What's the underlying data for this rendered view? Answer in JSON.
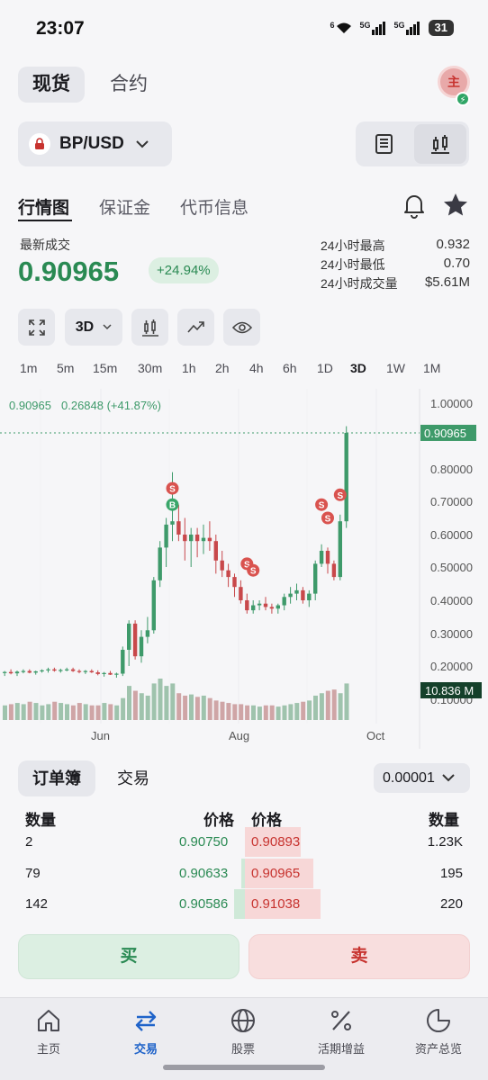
{
  "status": {
    "time": "23:07",
    "net1": "6",
    "net2": "5G",
    "net3": "5G",
    "battery": "31"
  },
  "top_tabs": [
    {
      "label": "现货",
      "active": true
    },
    {
      "label": "合约",
      "active": false
    }
  ],
  "avatar": {
    "text": "主",
    "badge": "⚡"
  },
  "pair": {
    "name": "BP/USD"
  },
  "sub_tabs": [
    {
      "label": "行情图",
      "active": true
    },
    {
      "label": "保证金",
      "active": false
    },
    {
      "label": "代币信息",
      "active": false
    }
  ],
  "ticker": {
    "last_label": "最新成交",
    "last_price": "0.90965",
    "change": "+24.94%",
    "stats": [
      {
        "label": "24小时最高",
        "value": "0.932"
      },
      {
        "label": "24小时最低",
        "value": "0.70"
      },
      {
        "label": "24小时成交量",
        "value": "$5.61M"
      }
    ]
  },
  "chart_toolbar": {
    "interval_select": "3D"
  },
  "timeframes": [
    "1m",
    "5m",
    "15m",
    "30m",
    "1h",
    "2h",
    "4h",
    "6h",
    "1D",
    "3D",
    "1W",
    "1M"
  ],
  "active_timeframe": "3D",
  "chart_data": {
    "type": "candlestick",
    "legend_text": {
      "price": "0.90965",
      "change": "0.26848 (+41.87%)"
    },
    "y_ticks": [
      "1.00000",
      "0.80000",
      "0.70000",
      "0.60000",
      "0.50000",
      "0.40000",
      "0.30000",
      "0.20000",
      "0.10000"
    ],
    "x_ticks": [
      "Jun",
      "Aug",
      "Oct"
    ],
    "price_tag": "0.90965",
    "volume_tag": "10.836 M",
    "ylim": [
      0.06,
      1.04
    ],
    "candles": [
      [
        0.18,
        0.185,
        0.17,
        0.182
      ],
      [
        0.182,
        0.19,
        0.175,
        0.178
      ],
      [
        0.178,
        0.186,
        0.17,
        0.183
      ],
      [
        0.183,
        0.19,
        0.178,
        0.185
      ],
      [
        0.185,
        0.19,
        0.178,
        0.18
      ],
      [
        0.18,
        0.186,
        0.174,
        0.184
      ],
      [
        0.184,
        0.19,
        0.18,
        0.187
      ],
      [
        0.187,
        0.195,
        0.18,
        0.19
      ],
      [
        0.19,
        0.195,
        0.183,
        0.186
      ],
      [
        0.186,
        0.192,
        0.18,
        0.188
      ],
      [
        0.188,
        0.195,
        0.184,
        0.19
      ],
      [
        0.19,
        0.195,
        0.182,
        0.185
      ],
      [
        0.185,
        0.19,
        0.178,
        0.182
      ],
      [
        0.182,
        0.188,
        0.176,
        0.185
      ],
      [
        0.185,
        0.19,
        0.179,
        0.181
      ],
      [
        0.181,
        0.187,
        0.172,
        0.176
      ],
      [
        0.176,
        0.182,
        0.168,
        0.179
      ],
      [
        0.179,
        0.185,
        0.173,
        0.174
      ],
      [
        0.174,
        0.18,
        0.165,
        0.177
      ],
      [
        0.177,
        0.26,
        0.17,
        0.25
      ],
      [
        0.25,
        0.34,
        0.2,
        0.33
      ],
      [
        0.33,
        0.34,
        0.22,
        0.23
      ],
      [
        0.23,
        0.31,
        0.21,
        0.29
      ],
      [
        0.29,
        0.35,
        0.27,
        0.31
      ],
      [
        0.31,
        0.47,
        0.3,
        0.46
      ],
      [
        0.46,
        0.58,
        0.44,
        0.56
      ],
      [
        0.56,
        0.65,
        0.5,
        0.63
      ],
      [
        0.63,
        0.79,
        0.58,
        0.64
      ],
      [
        0.64,
        0.69,
        0.58,
        0.6
      ],
      [
        0.6,
        0.65,
        0.52,
        0.58
      ],
      [
        0.58,
        0.62,
        0.5,
        0.6
      ],
      [
        0.6,
        0.62,
        0.53,
        0.58
      ],
      [
        0.58,
        0.63,
        0.54,
        0.59
      ],
      [
        0.59,
        0.64,
        0.55,
        0.58
      ],
      [
        0.58,
        0.6,
        0.48,
        0.52
      ],
      [
        0.52,
        0.55,
        0.47,
        0.49
      ],
      [
        0.49,
        0.51,
        0.44,
        0.47
      ],
      [
        0.47,
        0.48,
        0.41,
        0.44
      ],
      [
        0.44,
        0.46,
        0.39,
        0.4
      ],
      [
        0.4,
        0.42,
        0.36,
        0.37
      ],
      [
        0.37,
        0.4,
        0.36,
        0.385
      ],
      [
        0.385,
        0.4,
        0.37,
        0.39
      ],
      [
        0.39,
        0.41,
        0.37,
        0.38
      ],
      [
        0.38,
        0.39,
        0.36,
        0.375
      ],
      [
        0.375,
        0.39,
        0.36,
        0.385
      ],
      [
        0.385,
        0.42,
        0.37,
        0.41
      ],
      [
        0.41,
        0.44,
        0.39,
        0.42
      ],
      [
        0.42,
        0.45,
        0.4,
        0.43
      ],
      [
        0.43,
        0.44,
        0.39,
        0.4
      ],
      [
        0.4,
        0.43,
        0.38,
        0.42
      ],
      [
        0.42,
        0.52,
        0.4,
        0.51
      ],
      [
        0.51,
        0.57,
        0.5,
        0.55
      ],
      [
        0.55,
        0.56,
        0.48,
        0.51
      ],
      [
        0.51,
        0.52,
        0.46,
        0.47
      ],
      [
        0.47,
        0.66,
        0.46,
        0.64
      ],
      [
        0.64,
        0.93,
        0.62,
        0.90965
      ]
    ],
    "volumes": [
      12,
      13,
      14,
      13,
      15,
      14,
      12,
      13,
      15,
      14,
      13,
      12,
      14,
      13,
      12,
      12,
      14,
      13,
      12,
      18,
      28,
      24,
      22,
      20,
      30,
      34,
      28,
      30,
      22,
      20,
      21,
      19,
      20,
      18,
      16,
      15,
      14,
      13,
      13,
      12,
      12,
      11,
      12,
      12,
      11,
      12,
      13,
      14,
      15,
      16,
      20,
      22,
      24,
      25,
      22,
      30
    ]
  },
  "chart_badges": [
    {
      "text": "S"
    },
    {
      "text": "B"
    },
    {
      "text": "S"
    },
    {
      "text": "S"
    },
    {
      "text": "S"
    },
    {
      "text": "S"
    },
    {
      "text": "S"
    }
  ],
  "orderbook": {
    "tabs": [
      {
        "label": "订单簿",
        "active": true
      },
      {
        "label": "交易",
        "active": false
      }
    ],
    "precision": "0.00001",
    "headers": {
      "qty_left": "数量",
      "price_left": "价格",
      "price_right": "价格",
      "qty_right": "数量"
    },
    "rows": [
      {
        "bid_qty": "2",
        "bid_price": "0.90750",
        "ask_price": "0.90893",
        "ask_qty": "1.23K"
      },
      {
        "bid_qty": "79",
        "bid_price": "0.90633",
        "ask_price": "0.90965",
        "ask_qty": "195"
      },
      {
        "bid_qty": "142",
        "bid_price": "0.90586",
        "ask_price": "0.91038",
        "ask_qty": "220"
      }
    ]
  },
  "actions": {
    "buy": "买",
    "sell": "卖"
  },
  "bottom_nav": [
    {
      "label": "主页",
      "icon": "home-icon",
      "active": false
    },
    {
      "label": "交易",
      "icon": "swap-icon",
      "active": true
    },
    {
      "label": "股票",
      "icon": "globe-icon",
      "active": false
    },
    {
      "label": "活期增益",
      "icon": "percent-icon",
      "active": false
    },
    {
      "label": "资产总览",
      "icon": "pie-icon",
      "active": false
    }
  ],
  "colors": {
    "up": "#3e9a6a",
    "down": "#c8484b",
    "accent": "#1f63c9"
  }
}
